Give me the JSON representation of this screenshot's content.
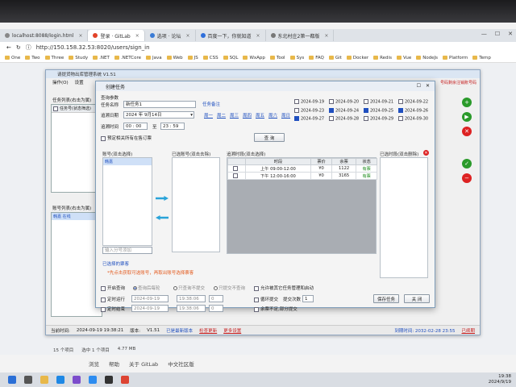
{
  "browser": {
    "tabs": [
      {
        "label": "localhost:8088/login.html",
        "active": false
      },
      {
        "label": "登录 · GitLab",
        "active": true
      },
      {
        "label": "选项 · 论坛",
        "active": false
      },
      {
        "label": "百度一下，你就知道",
        "active": false
      },
      {
        "label": "东北村庄2第一都版",
        "active": false
      }
    ],
    "url": "http://150.158.32.53:8020/users/sign_in",
    "bookmarks": [
      "One",
      "Two",
      "Three",
      "Study",
      ".NET",
      ".NETCore",
      "Java",
      "Web",
      "JS",
      "CSS",
      "SQL",
      "WxApp",
      "Tool",
      "Sys",
      "FAQ",
      "Git",
      "Docker",
      "Redis",
      "Vue",
      "NodeJs",
      "Platform",
      "Temp"
    ]
  },
  "app": {
    "title": "请提货物出库管理系统 V1.51",
    "menu": [
      "操作(O)",
      "设置"
    ],
    "task_list_header": "任务列表(右击为属)",
    "task_col_header": "任务号(状态筛选)",
    "account_list_header": "账号列表(右击为属)",
    "account_selected": "韩嘉 在线",
    "status": {
      "time_label": "当前时间:",
      "time_value": "2024-09-19 19:38:21",
      "version_label": "版本:",
      "version": "V1.51",
      "latest": "已是最新版本",
      "check_update": "检查更新",
      "more_settings": "更多设置",
      "expire": "到期时间: 2032-02-28 23:55",
      "expire_link": "已续期"
    },
    "right_badge": "号码剩余注销账号码"
  },
  "dialog": {
    "title": "创建任务",
    "section_params": "查询参数",
    "task_name_label": "任务名称",
    "task_name_value": "新任务1",
    "task_remark_label": "任务备注",
    "arrive_date_label": "追溯日期",
    "arrive_date_value": "2024 年 9月14日",
    "weekdays": [
      "周一",
      "周二",
      "周三",
      "周四",
      "周五",
      "周六",
      "周日"
    ],
    "query_time_label": "追溯时间",
    "time_from": "00 : 00",
    "time_to_label": "至",
    "time_to": "23 : 59",
    "query_button": "查 询",
    "only_selected_label": "预定相关所有在售订票",
    "dates": [
      {
        "date": "2024-09-19",
        "checked": false
      },
      {
        "date": "2024-09-20",
        "checked": false
      },
      {
        "date": "2024-09-21",
        "checked": false
      },
      {
        "date": "2024-09-22",
        "checked": false
      },
      {
        "date": "2024-09-23",
        "checked": false
      },
      {
        "date": "2024-09-24",
        "checked": true
      },
      {
        "date": "2024-09-25",
        "checked": true
      },
      {
        "date": "2024-09-26",
        "checked": true
      },
      {
        "date": "2024-09-27",
        "checked": true
      },
      {
        "date": "2024-09-28",
        "checked": false
      },
      {
        "date": "2024-09-29",
        "checked": false
      },
      {
        "date": "2024-09-30",
        "checked": false
      }
    ],
    "account_box_title": "账号(双击选择)",
    "account_item": "韩嘉",
    "account_add_placeholder": "输入分号添加",
    "selected_box_title": "已选账号(双击去除)",
    "result_box_title": "追溯时段(双击选择)",
    "table_headers": [
      "",
      "时段",
      "票价",
      "余票",
      "状态"
    ],
    "rows": [
      {
        "period": "上午 09:00-12:00",
        "price": "¥0",
        "left": "1122",
        "status": "有票"
      },
      {
        "period": "下午 12:00-16:00",
        "price": "¥0",
        "left": "3165",
        "status": "有票"
      }
    ],
    "selected_period_title": "已选时段(双击删除)",
    "selected_tickets_label": "已选择的票客",
    "hint": "*先点击获取可选账号，再取出账号选择票客",
    "submit_options": {
      "cycle_label": "开启查询",
      "radio1": "查询后每轮",
      "radio2": "只查询不提交",
      "radio3": "只提交不查询",
      "timing_label": "定时运行",
      "timing_date": "2024-09-19",
      "timing_time": "19:38:06",
      "timing_count": "0",
      "stop_label": "定时结束",
      "stop_date": "2024-09-19",
      "stop_time": "19:38:06",
      "stop_count": "0",
      "allow_other_label": "允许被其它任务管理和启动",
      "loop_label": "循环提交",
      "submit_times_label": "提交次数",
      "submit_times_value": "1",
      "not_enough_label": "余票不足,部分提交"
    },
    "save_button": "保存任务",
    "close_button": "关 闭"
  },
  "page_footer": {
    "links": [
      "浏览",
      "帮助",
      "关于 GitLab",
      "中文社区版"
    ],
    "count": "15 个项目",
    "selected": "选中 1 个项目",
    "size": "4.77 MB"
  },
  "taskbar": {
    "clock": "19:38",
    "date": "2024/9/19"
  }
}
